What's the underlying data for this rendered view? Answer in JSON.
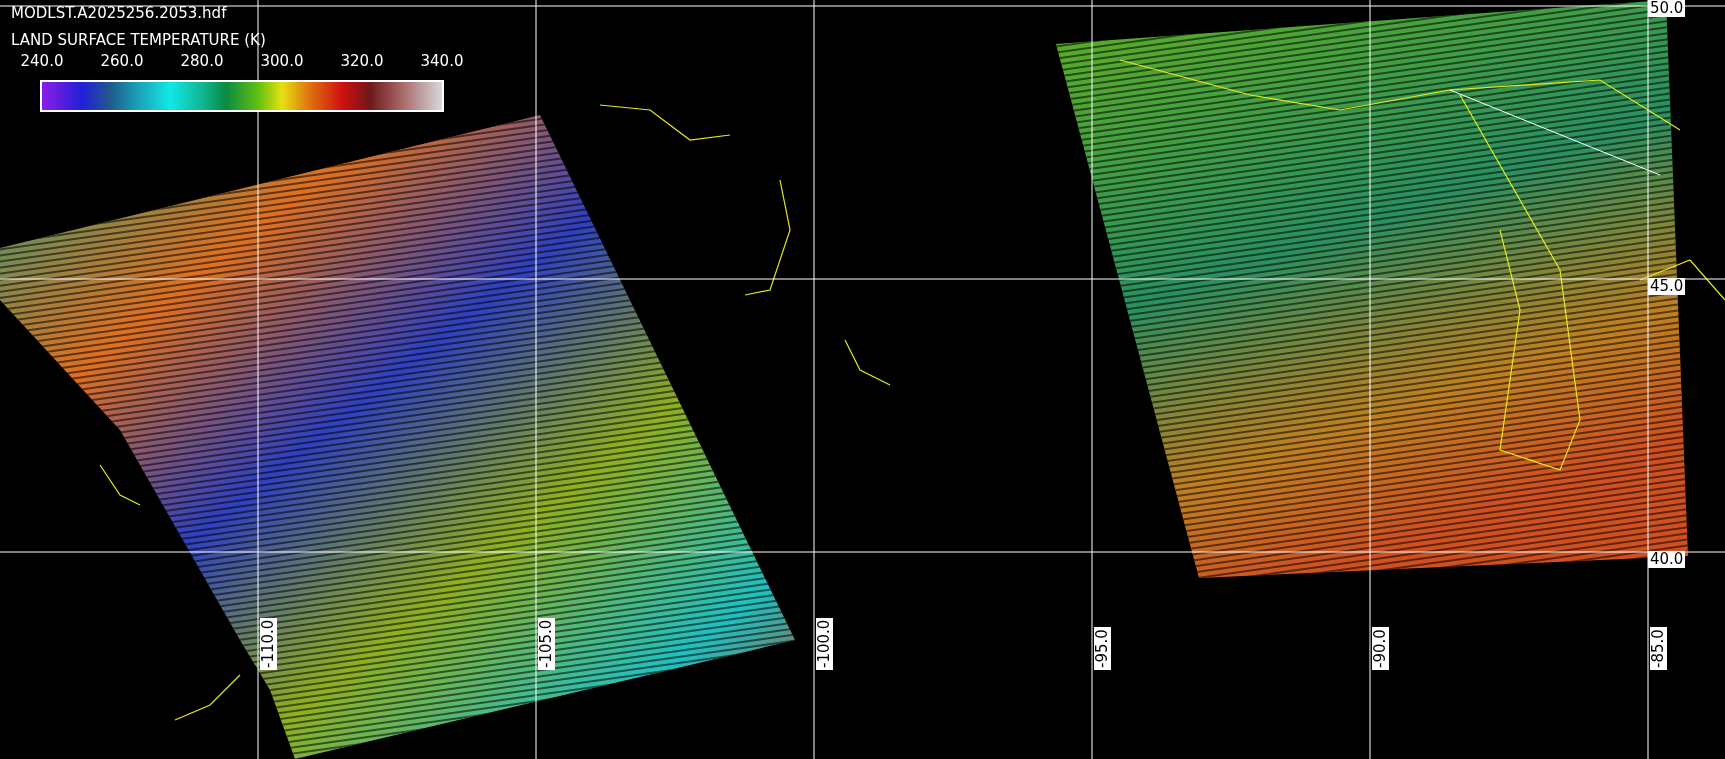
{
  "file_name": "MODLST.A2025256.2053.hdf",
  "variable": "LAND SURFACE TEMPERATURE (K)",
  "colorbar": {
    "ticks": [
      "240.0",
      "260.0",
      "280.0",
      "300.0",
      "320.0",
      "340.0"
    ]
  },
  "longitude_labels": [
    "-110.0",
    "-105.0",
    "-100.0",
    "-95.0",
    "-90.0",
    "-85.0"
  ],
  "latitude_labels": [
    "50.0",
    "45.0",
    "40.0"
  ]
}
